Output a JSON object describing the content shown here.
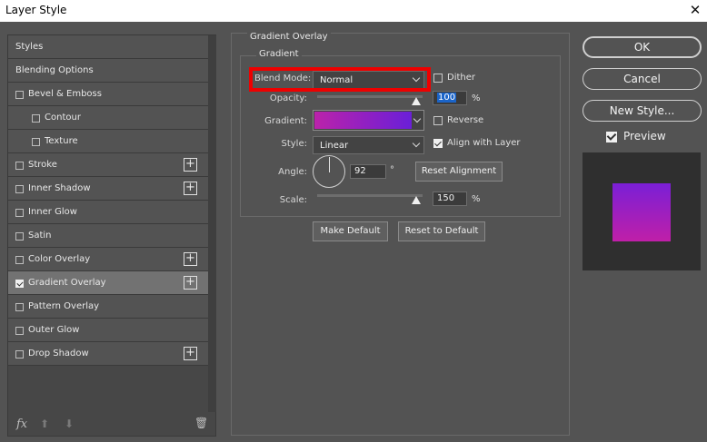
{
  "window": {
    "title": "Layer Style",
    "close_glyph": "✕"
  },
  "sidebar": {
    "items": [
      {
        "label": "Styles",
        "has_checkbox": false,
        "checked": false,
        "has_plus": false
      },
      {
        "label": "Blending Options",
        "has_checkbox": false,
        "checked": false,
        "has_plus": false
      },
      {
        "label": "Bevel & Emboss",
        "has_checkbox": true,
        "checked": false,
        "has_plus": false
      },
      {
        "label": "Contour",
        "has_checkbox": true,
        "checked": false,
        "has_plus": false
      },
      {
        "label": "Texture",
        "has_checkbox": true,
        "checked": false,
        "has_plus": false
      },
      {
        "label": "Stroke",
        "has_checkbox": true,
        "checked": false,
        "has_plus": true
      },
      {
        "label": "Inner Shadow",
        "has_checkbox": true,
        "checked": false,
        "has_plus": true
      },
      {
        "label": "Inner Glow",
        "has_checkbox": true,
        "checked": false,
        "has_plus": false
      },
      {
        "label": "Satin",
        "has_checkbox": true,
        "checked": false,
        "has_plus": false
      },
      {
        "label": "Color Overlay",
        "has_checkbox": true,
        "checked": false,
        "has_plus": true
      },
      {
        "label": "Gradient Overlay",
        "has_checkbox": true,
        "checked": true,
        "has_plus": true,
        "selected": true
      },
      {
        "label": "Pattern Overlay",
        "has_checkbox": true,
        "checked": false,
        "has_plus": false
      },
      {
        "label": "Outer Glow",
        "has_checkbox": true,
        "checked": false,
        "has_plus": false
      },
      {
        "label": "Drop Shadow",
        "has_checkbox": true,
        "checked": false,
        "has_plus": true
      }
    ],
    "plus_glyph": "+",
    "footer": {
      "fx_label": "fx",
      "up_glyph": "⬆",
      "down_glyph": "⬇",
      "trash_glyph": "🗑"
    }
  },
  "gradient_overlay": {
    "group_title": "Gradient Overlay",
    "subgroup_title": "Gradient",
    "blend_mode": {
      "label": "Blend Mode:",
      "value": "Normal"
    },
    "dither": {
      "label": "Dither",
      "checked": false
    },
    "opacity": {
      "label": "Opacity:",
      "value": "100",
      "unit": "%",
      "level": 100
    },
    "gradient": {
      "label": "Gradient:",
      "color_start": "#bb22aa",
      "color_end": "#6a1fd8"
    },
    "reverse": {
      "label": "Reverse",
      "checked": false
    },
    "style": {
      "label": "Style:",
      "value": "Linear"
    },
    "align_with_layer": {
      "label": "Align with Layer",
      "checked": true
    },
    "angle": {
      "label": "Angle:",
      "value": "92",
      "unit": "°"
    },
    "reset_alignment_label": "Reset Alignment",
    "scale": {
      "label": "Scale:",
      "value": "150",
      "unit": "%",
      "level": 150
    },
    "make_default_label": "Make Default",
    "reset_to_default_label": "Reset to Default"
  },
  "actions": {
    "ok_label": "OK",
    "cancel_label": "Cancel",
    "new_style_label": "New Style...",
    "preview_label": "Preview",
    "preview_checked": true
  },
  "colors": {
    "highlight_border": "#ee0000",
    "panel_bg": "#535353",
    "selection_blue": "#1b64c8"
  }
}
